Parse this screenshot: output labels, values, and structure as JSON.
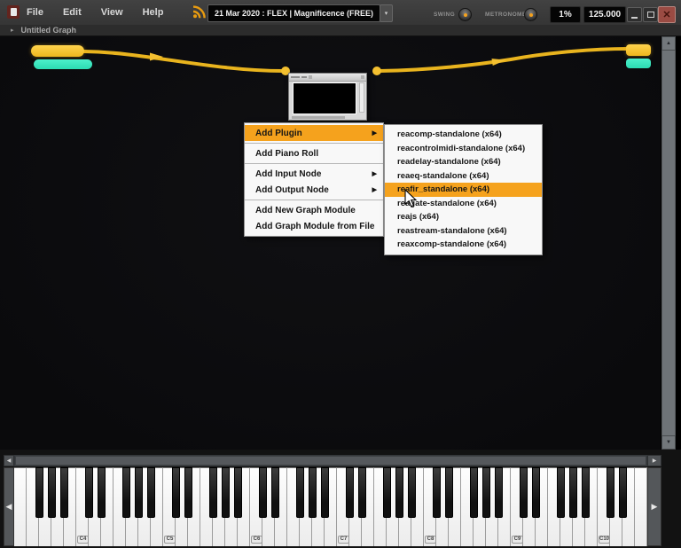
{
  "colors": {
    "accent_orange": "#f5a21d",
    "gold": "#eeb71e",
    "teal": "#2bdcb2",
    "close_red": "#9a4b43",
    "menu_bg": "#f8f8f8",
    "topbar_bg": "#3a3a3a",
    "canvas_bg": "#0b0b0d"
  },
  "icons": {
    "collapse_arrow": "▸",
    "submenu_arrow": "▶",
    "dropdown_arrow": "▾",
    "close": "✕",
    "scroll_up": "▲",
    "scroll_down": "▼",
    "scroll_left": "◀",
    "scroll_right": "▶"
  },
  "menu_bar": {
    "menus": [
      "File",
      "Edit",
      "View",
      "Help"
    ],
    "preset_display": "21 Mar 2020 : FLEX | Magnificence (FREE)",
    "swing_label": "SWING",
    "metronome_label": "METRONOME",
    "swing_percent": "1%",
    "tempo": "125.000"
  },
  "graph_bar": {
    "title": "Untitled Graph"
  },
  "context_menu": {
    "items": [
      {
        "type": "item",
        "label": "Add Plugin",
        "has_submenu": true,
        "highlighted": true
      },
      {
        "type": "separator"
      },
      {
        "type": "item",
        "label": "Add Piano Roll",
        "has_submenu": false
      },
      {
        "type": "separator"
      },
      {
        "type": "item",
        "label": "Add Input Node",
        "has_submenu": true
      },
      {
        "type": "item",
        "label": "Add Output Node",
        "has_submenu": true
      },
      {
        "type": "separator"
      },
      {
        "type": "item",
        "label": "Add New Graph Module",
        "has_submenu": false
      },
      {
        "type": "item",
        "label": "Add Graph Module from File",
        "has_submenu": false
      }
    ]
  },
  "plugin_submenu": {
    "highlighted_index": 4,
    "items": [
      "reacomp-standalone (x64)",
      "reacontrolmidi-standalone (x64)",
      "readelay-standalone (x64)",
      "reaeq-standalone (x64)",
      "reafir_standalone (x64)",
      "reagate-standalone (x64)",
      "reajs (x64)",
      "reastream-standalone (x64)",
      "reaxcomp-standalone (x64)"
    ]
  },
  "keyboard": {
    "octave_labels": [
      "C4",
      "C5",
      "C6",
      "C7",
      "C8",
      "C9",
      "C10"
    ]
  }
}
